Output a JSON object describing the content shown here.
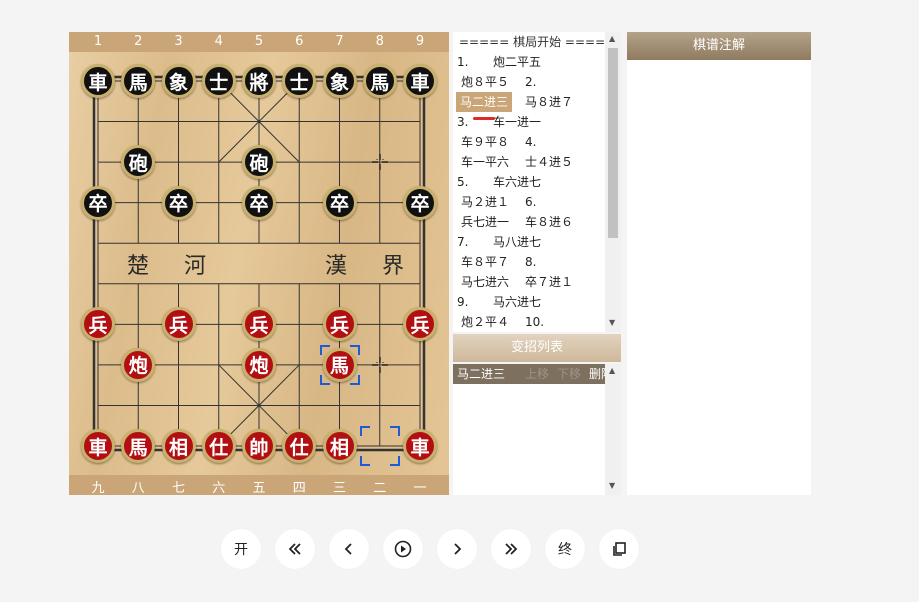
{
  "board": {
    "top_numbers": [
      "1",
      "2",
      "3",
      "4",
      "5",
      "6",
      "7",
      "8",
      "9"
    ],
    "bottom_numbers": [
      "九",
      "八",
      "七",
      "六",
      "五",
      "四",
      "三",
      "二",
      "一"
    ],
    "river_left": "楚 河",
    "river_right": "漢 界",
    "pieces": [
      {
        "c": 0,
        "r": 0,
        "t": "車",
        "s": "black"
      },
      {
        "c": 1,
        "r": 0,
        "t": "馬",
        "s": "black"
      },
      {
        "c": 2,
        "r": 0,
        "t": "象",
        "s": "black"
      },
      {
        "c": 3,
        "r": 0,
        "t": "士",
        "s": "black"
      },
      {
        "c": 4,
        "r": 0,
        "t": "將",
        "s": "black"
      },
      {
        "c": 5,
        "r": 0,
        "t": "士",
        "s": "black"
      },
      {
        "c": 6,
        "r": 0,
        "t": "象",
        "s": "black"
      },
      {
        "c": 7,
        "r": 0,
        "t": "馬",
        "s": "black"
      },
      {
        "c": 8,
        "r": 0,
        "t": "車",
        "s": "black"
      },
      {
        "c": 1,
        "r": 2,
        "t": "砲",
        "s": "black"
      },
      {
        "c": 4,
        "r": 2,
        "t": "砲",
        "s": "black"
      },
      {
        "c": 0,
        "r": 3,
        "t": "卒",
        "s": "black"
      },
      {
        "c": 2,
        "r": 3,
        "t": "卒",
        "s": "black"
      },
      {
        "c": 4,
        "r": 3,
        "t": "卒",
        "s": "black"
      },
      {
        "c": 6,
        "r": 3,
        "t": "卒",
        "s": "black"
      },
      {
        "c": 8,
        "r": 3,
        "t": "卒",
        "s": "black"
      },
      {
        "c": 0,
        "r": 6,
        "t": "兵",
        "s": "red"
      },
      {
        "c": 2,
        "r": 6,
        "t": "兵",
        "s": "red"
      },
      {
        "c": 4,
        "r": 6,
        "t": "兵",
        "s": "red"
      },
      {
        "c": 6,
        "r": 6,
        "t": "兵",
        "s": "red"
      },
      {
        "c": 8,
        "r": 6,
        "t": "兵",
        "s": "red"
      },
      {
        "c": 1,
        "r": 7,
        "t": "炮",
        "s": "red"
      },
      {
        "c": 4,
        "r": 7,
        "t": "炮",
        "s": "red"
      },
      {
        "c": 6,
        "r": 7,
        "t": "馬",
        "s": "red"
      },
      {
        "c": 0,
        "r": 9,
        "t": "車",
        "s": "red"
      },
      {
        "c": 1,
        "r": 9,
        "t": "馬",
        "s": "red"
      },
      {
        "c": 2,
        "r": 9,
        "t": "相",
        "s": "red"
      },
      {
        "c": 3,
        "r": 9,
        "t": "仕",
        "s": "red"
      },
      {
        "c": 4,
        "r": 9,
        "t": "帥",
        "s": "red"
      },
      {
        "c": 5,
        "r": 9,
        "t": "仕",
        "s": "red"
      },
      {
        "c": 6,
        "r": 9,
        "t": "相",
        "s": "red"
      },
      {
        "c": 8,
        "r": 9,
        "t": "車",
        "s": "red"
      }
    ],
    "selections": [
      {
        "c": 6,
        "r": 7
      },
      {
        "c": 7,
        "r": 9
      }
    ],
    "cursors": [
      {
        "c": 7,
        "r": 2
      },
      {
        "c": 7,
        "r": 7
      }
    ]
  },
  "record": {
    "header": "===== 棋局开始 =====",
    "rows": [
      {
        "a": "1.",
        "b": "炮二平五"
      },
      {
        "a": "炮８平５",
        "b": "2."
      },
      {
        "a": "马二进三",
        "b": "马８进７",
        "hl": true
      },
      {
        "a": "3.",
        "b": "车一进一"
      },
      {
        "a": "车９平８",
        "b": "4."
      },
      {
        "a": "车一平六",
        "b": "士４进５"
      },
      {
        "a": "5.",
        "b": "车六进七"
      },
      {
        "a": "马２进１",
        "b": "6."
      },
      {
        "a": "兵七进一",
        "b": "车８进６"
      },
      {
        "a": "7.",
        "b": "马八进七"
      },
      {
        "a": "车８平７",
        "b": "8."
      },
      {
        "a": "马七进六",
        "b": "卒７进１"
      },
      {
        "a": "9.",
        "b": "马六进七"
      },
      {
        "a": "炮２平４",
        "b": "10."
      }
    ]
  },
  "variations": {
    "title": "变招列表",
    "item": "马二进三",
    "up": "上移",
    "down": "下移",
    "delete": "删除"
  },
  "notes": {
    "title": "棋谱注解"
  },
  "controls": {
    "start": "开",
    "end": "终"
  },
  "colors": {
    "accent": "#c9a577",
    "red_piece": "#b10f12",
    "selection": "#1e5bd8"
  }
}
